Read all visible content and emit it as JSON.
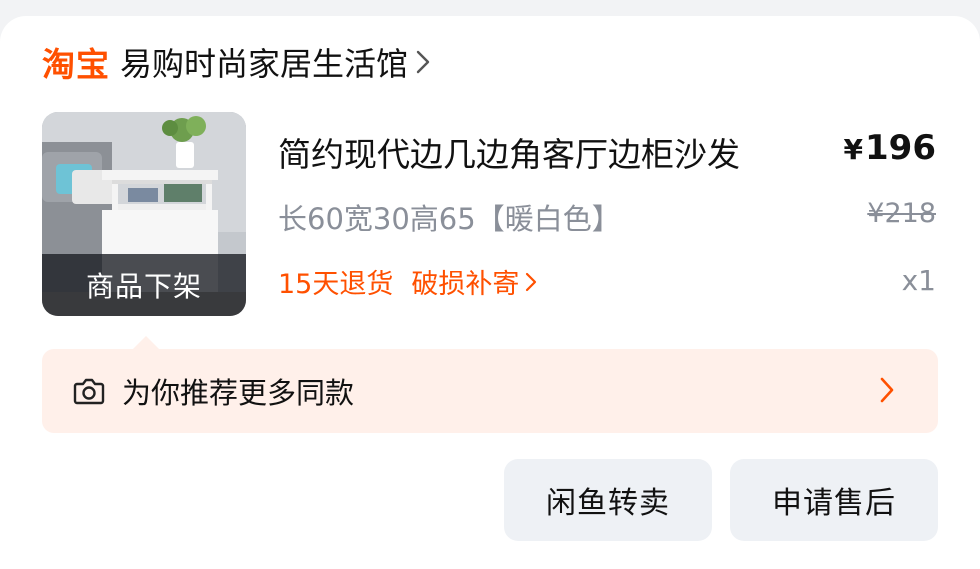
{
  "shop": {
    "platform": "淘宝",
    "name": "易购时尚家居生活馆"
  },
  "product": {
    "title": "简约现代边几边角客厅边柜沙发",
    "price_symbol": "¥",
    "price": "196",
    "sku": "长60宽30高65【暖白色】",
    "original_price": "¥218",
    "quantity": "x1",
    "image_overlay": "商品下架",
    "services": [
      "15天退货",
      "破损补寄"
    ]
  },
  "recommend": {
    "text": "为你推荐更多同款"
  },
  "actions": {
    "resell": "闲鱼转卖",
    "after_sale": "申请售后"
  },
  "colors": {
    "brand_orange": "#ff5000",
    "recommend_bg": "#fff0ea",
    "button_bg": "#eef1f5",
    "muted_text": "#8a8f99"
  }
}
